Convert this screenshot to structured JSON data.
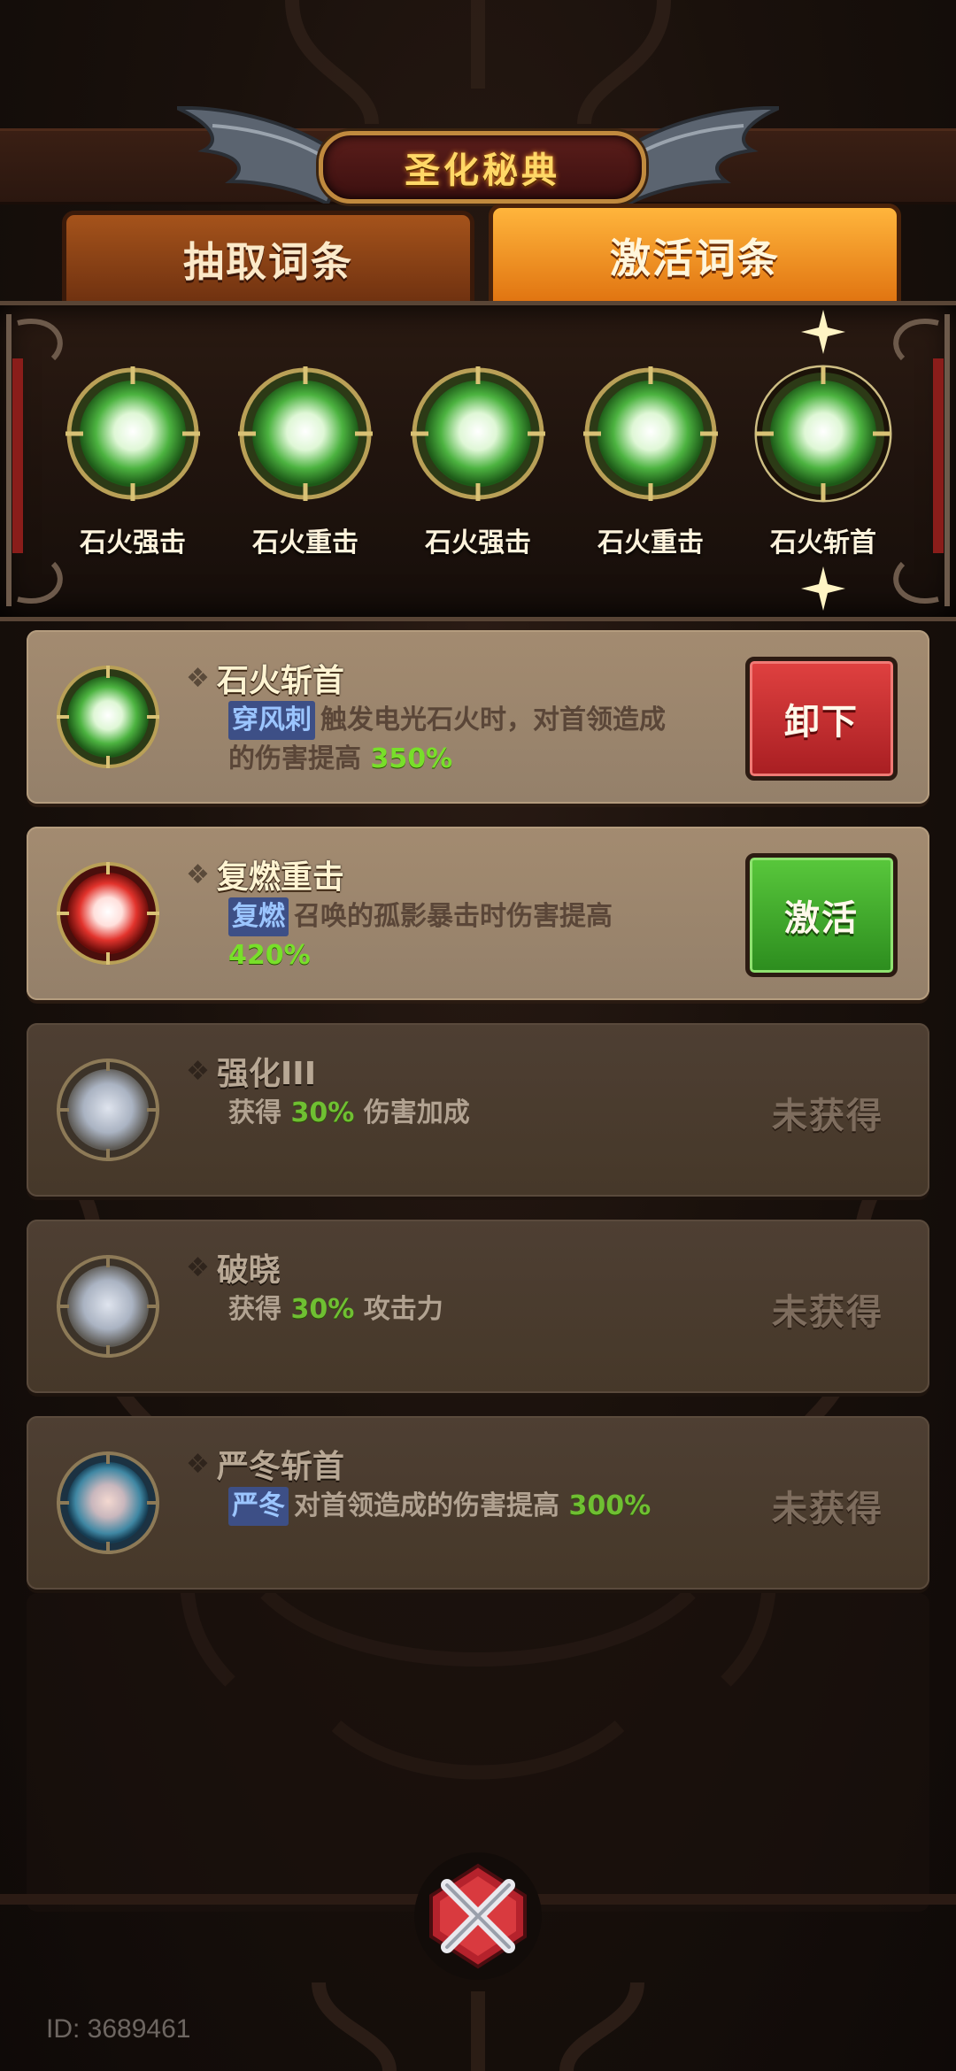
{
  "title": "圣化秘典",
  "tabs": {
    "draw_label": "抽取词条",
    "activate_label": "激活词条"
  },
  "equipped": [
    {
      "label": "石火强击",
      "color": "green"
    },
    {
      "label": "石火重击",
      "color": "green"
    },
    {
      "label": "石火强击",
      "color": "green"
    },
    {
      "label": "石火重击",
      "color": "green"
    },
    {
      "label": "石火斩首",
      "color": "green"
    }
  ],
  "cards": [
    {
      "name": "石火斩首",
      "tag": "穿风刺",
      "desc_a": "触发电光石火时，对首领造成",
      "desc_b": "的伤害提高",
      "pct": "350%",
      "action": "卸下",
      "orb": "green"
    },
    {
      "name": "复燃重击",
      "tag": "复燃",
      "desc_a": "召唤的孤影暴击时伤害提高",
      "pct": "420%",
      "action": "激活",
      "orb": "red"
    },
    {
      "name": "强化III",
      "prefix": "获得",
      "pct": "30%",
      "suffix": "伤害加成",
      "status": "未获得",
      "orb": "gray"
    },
    {
      "name": "破晓",
      "prefix": "获得",
      "pct": "30%",
      "suffix": "攻击力",
      "status": "未获得",
      "orb": "gray"
    },
    {
      "name": "严冬斩首",
      "tag": "严冬",
      "desc_a": "对首领造成的伤害提高",
      "pct": "300%",
      "status": "未获得",
      "orb": "blue"
    }
  ],
  "player_id": "ID: 3689461",
  "colors": {
    "accent_gold": "#ffd867",
    "orb_green": "#7ee67a",
    "orb_red": "#ff5a50",
    "pct_green": "#78df2a"
  }
}
